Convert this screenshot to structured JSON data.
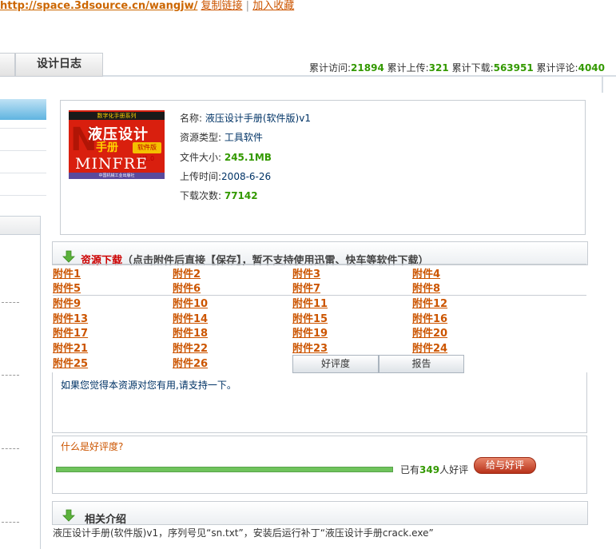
{
  "topbar": {
    "url": "http://space.3dsource.cn/wangjw/",
    "copy_link": "复制链接",
    "separator": "|",
    "add_favorite": "加入收藏"
  },
  "tabs": {
    "blog": "设计日志"
  },
  "stats": {
    "visits_label": "累计访问:",
    "visits": "21894",
    "uploads_label": "累计上传:",
    "uploads": "321",
    "downloads_label": "累计下载:",
    "downloads": "563951",
    "comments_label": "累计评论:",
    "comments": "4040"
  },
  "cover": {
    "series": "数字化手册系列",
    "title_line1": "液压设计",
    "title_line2": "手册",
    "version": "软件版V1.0",
    "brand": "MINFRE",
    "publisher": "中国机械工业出版社"
  },
  "resource": {
    "name_label": "名称: ",
    "name": "液压设计手册(软件版)v1",
    "type_label": "资源类型: ",
    "type": "工具软件",
    "size_label": "文件大小: ",
    "size": "245.1MB",
    "time_label": "上传时间:",
    "time": "2008-6-26",
    "count_label": "下载次数: ",
    "count": "77142"
  },
  "download": {
    "title": "资源下载",
    "note": "（点击附件后直接【保存】，暂不支持使用迅雷、快车等软件下载）",
    "attachments": [
      "附件1",
      "附件2",
      "附件3",
      "附件4",
      "附件5",
      "附件6",
      "附件7",
      "附件8",
      "附件9",
      "附件10",
      "附件11",
      "附件12",
      "附件13",
      "附件14",
      "附件15",
      "附件16",
      "附件17",
      "附件18",
      "附件19",
      "附件20",
      "附件21",
      "附件22",
      "附件23",
      "附件24",
      "附件25",
      "附件26"
    ]
  },
  "rating_tabs": {
    "good": "好评度",
    "report": "报告"
  },
  "rating": {
    "message": "如果您觉得本资源对您有用,请支持一下。",
    "question": "什么是好评度?",
    "count_prefix": "已有",
    "count": "349",
    "count_suffix": "人好评",
    "progress": 1.0,
    "button": "给与好评"
  },
  "related": {
    "title": "相关介绍",
    "text": "液压设计手册(软件版)v1，序列号见“sn.txt”，安装后运行补丁“液压设计手册crack.exe”"
  },
  "colors": {
    "accent": "#cc5500",
    "number_green": "#339900",
    "title_red": "#cc0000",
    "border": "#c8cdd3"
  }
}
